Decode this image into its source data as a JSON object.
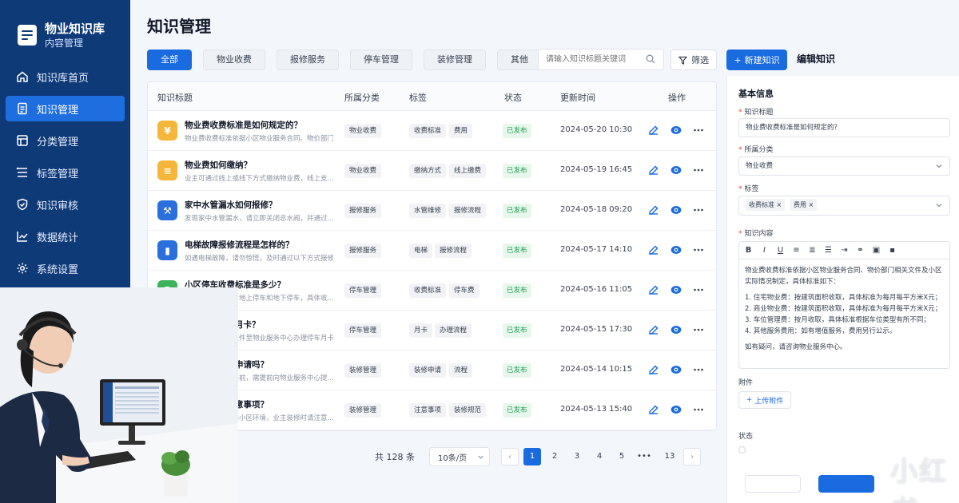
{
  "brand": {
    "title": "物业知识库",
    "subtitle": "内容管理"
  },
  "nav": [
    {
      "label": "知识库首页",
      "icon": "home-icon"
    },
    {
      "label": "知识管理",
      "icon": "document-icon",
      "active": true
    },
    {
      "label": "分类管理",
      "icon": "category-icon"
    },
    {
      "label": "标签管理",
      "icon": "tag-icon"
    },
    {
      "label": "知识审核",
      "icon": "shield-check-icon"
    },
    {
      "label": "数据统计",
      "icon": "chart-icon"
    },
    {
      "label": "系统设置",
      "icon": "gear-icon"
    }
  ],
  "page_title": "知识管理",
  "categories": [
    "全部",
    "物业收费",
    "报修服务",
    "停车管理",
    "装修管理",
    "其他"
  ],
  "search": {
    "placeholder": "请输入知识标题关键词"
  },
  "filter_label": "筛选",
  "new_label": "新建知识",
  "edit_title": "编辑知识",
  "table": {
    "headers": [
      "知识标题",
      "所属分类",
      "标签",
      "状态",
      "更新时间",
      "操作"
    ],
    "rows": [
      {
        "title": "物业费收费标准是如何规定的？",
        "desc": "物业费收费标准依据小区物业服务合同、物价部门...",
        "category": "物业收费",
        "tags": [
          "收费标准",
          "费用"
        ],
        "status": "已发布",
        "time": "2024-05-20 10:30",
        "icon": "coin-icon",
        "color": "#f5b73b"
      },
      {
        "title": "物业费如何缴纳？",
        "desc": "业主可通过线上或线下方式缴纳物业费，线上支...",
        "category": "物业收费",
        "tags": [
          "缴纳方式",
          "线上缴费"
        ],
        "status": "已发布",
        "time": "2024-05-19 16:45",
        "icon": "bill-icon",
        "color": "#f5b73b"
      },
      {
        "title": "家中水管漏水如何报修？",
        "desc": "发现家中水管漏水，请立即关闭总水阀，并通过...",
        "category": "报修服务",
        "tags": [
          "水管维修",
          "报修流程"
        ],
        "status": "已发布",
        "time": "2024-05-18 09:20",
        "icon": "wrench-icon",
        "color": "#2a6fdb"
      },
      {
        "title": "电梯故障报修流程是怎样的？",
        "desc": "如遇电梯故障，请勿惊慌，及时通过以下方式报修...",
        "category": "报修服务",
        "tags": [
          "电梯",
          "报修流程"
        ],
        "status": "已发布",
        "time": "2024-05-17 14:10",
        "icon": "elevator-icon",
        "color": "#2a6fdb"
      },
      {
        "title": "小区停车收费标准是多少？",
        "desc": "小区停车收费分为地上停车和地下停车，具体收...",
        "category": "停车管理",
        "tags": [
          "收费标准",
          "停车费"
        ],
        "status": "已发布",
        "time": "2024-05-16 11:05",
        "icon": "parking-icon",
        "color": "#3bb35a"
      },
      {
        "title": "如何办理停车月卡？",
        "desc": "业主可携带相关证件至物业服务中心办理停车月卡...",
        "category": "停车管理",
        "tags": [
          "月卡",
          "办理流程"
        ],
        "status": "已发布",
        "time": "2024-05-15 17:30",
        "icon": "car-icon",
        "color": "#3bb35a"
      },
      {
        "title": "装修需要提前申请吗？",
        "desc": "业主进行室内装修前，需提前向物业服务中心提...",
        "category": "装修管理",
        "tags": [
          "装修申请",
          "流程"
        ],
        "status": "已发布",
        "time": "2024-05-14 10:15",
        "icon": "paint-roller-icon",
        "color": "#8a5cd6"
      },
      {
        "title": "装修有哪些注意事项？",
        "desc": "为确保装修安全和小区环境，业主装修时请注意...",
        "category": "装修管理",
        "tags": [
          "注意事项",
          "装修规范"
        ],
        "status": "已发布",
        "time": "2024-05-13 15:40",
        "icon": "shield-icon",
        "color": "#8a5cd6"
      }
    ]
  },
  "pagination": {
    "total": "共 128 条",
    "page_size": "10条/页",
    "pages": [
      "1",
      "2",
      "3",
      "4",
      "5",
      "•••",
      "13"
    ],
    "current": "1"
  },
  "form": {
    "section": "基本信息",
    "title_label": "知识标题",
    "title_value": "物业费收费标准是如何规定的？",
    "category_label": "所属分类",
    "category_value": "物业收费",
    "tags_label": "标签",
    "tags": [
      "收费标准",
      "费用"
    ],
    "content_label": "知识内容",
    "content": {
      "intro": "物业费收费标准依据小区物业服务合同、物价部门相关文件及小区实际情况制定，具体标准如下：",
      "items": [
        "1. 住宅物业费：按建筑面积收取，具体标准为每月每平方米X元；",
        "2. 商业物业费：按建筑面积收取，具体标准为每月每平方米X元；",
        "3. 车位管理费：按月收取，具体标准根据车位类型有所不同；",
        "4. 其他服务费用：如有增值服务，费用另行公示。"
      ],
      "outro": "如有疑问，请咨询物业服务中心。"
    },
    "attachment_label": "附件",
    "upload_label": "上传附件",
    "status_label": "状态"
  },
  "watermark": "小红书"
}
